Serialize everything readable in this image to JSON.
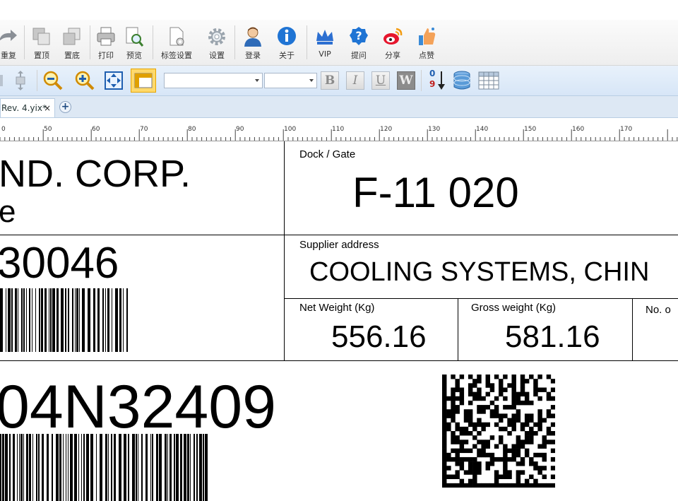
{
  "ribbon": {
    "items": [
      {
        "label": "重复",
        "icon": "redo-icon"
      },
      {
        "label": "置顶",
        "icon": "bring-to-front-icon"
      },
      {
        "label": "置底",
        "icon": "send-to-back-icon"
      },
      {
        "label": "打印",
        "icon": "printer-icon"
      },
      {
        "label": "预览",
        "icon": "preview-icon"
      },
      {
        "label": "标签设置",
        "icon": "label-settings-icon"
      },
      {
        "label": "设置",
        "icon": "gear-icon"
      },
      {
        "label": "登录",
        "icon": "user-icon"
      },
      {
        "label": "关于",
        "icon": "info-icon"
      },
      {
        "label": "VIP",
        "icon": "crown-icon"
      },
      {
        "label": "提问",
        "icon": "question-icon"
      },
      {
        "label": "分享",
        "icon": "weibo-icon"
      },
      {
        "label": "点赞",
        "icon": "thumbs-up-icon"
      }
    ]
  },
  "format_bar": {
    "font_family_value": "",
    "font_size_value": "",
    "bold": "B",
    "italic": "I",
    "underline": "U",
    "wordwrap": "W",
    "sort_top": "0",
    "sort_bottom": "9"
  },
  "tabs": [
    {
      "label": "Rev. 4.yix*",
      "close": "×"
    }
  ],
  "new_tab": "+",
  "ruler": {
    "labels": [
      "0",
      "50",
      "60",
      "70",
      "80",
      "90",
      "100",
      "110",
      "120",
      "130",
      "140",
      "150",
      "160",
      "170"
    ]
  },
  "label": {
    "company_line1": "ND. CORP.",
    "company_line2": "e",
    "dock_caption": "Dock / Gate",
    "dock_value": "F-11 020",
    "part_number": "30046",
    "supplier_caption": "Supplier address",
    "supplier_value": "COOLING SYSTEMS, CHIN",
    "net_weight_caption": "Net Weight (Kg)",
    "net_weight_value": "556.16",
    "gross_weight_caption": "Gross weight (Kg)",
    "gross_weight_value": "581.16",
    "number_caption": "No. o",
    "serial": "04N32409"
  }
}
